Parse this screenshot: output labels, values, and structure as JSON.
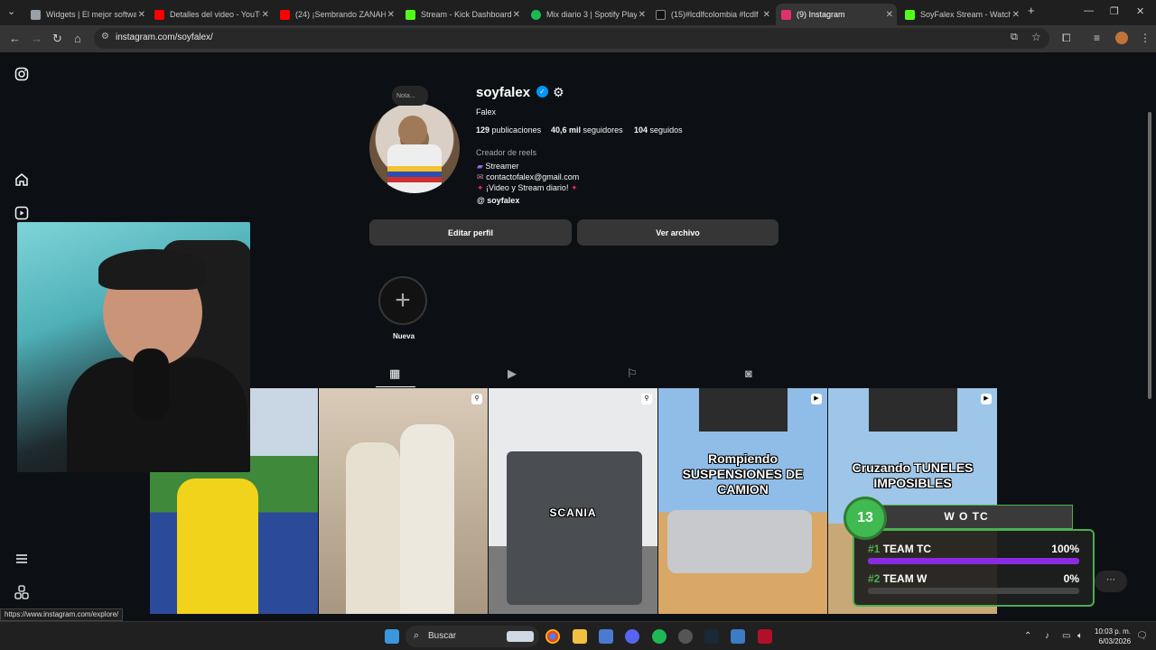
{
  "browser": {
    "tabs": [
      {
        "title": "Widgets | El mejor software",
        "favicon_color": "#9aa0a6"
      },
      {
        "title": "Detalles del video - YouTube",
        "favicon_color": "#ff0000"
      },
      {
        "title": "(24) ¡Sembrando ZANAHORIAS",
        "favicon_color": "#ff0000"
      },
      {
        "title": "Stream - Kick Dashboard",
        "favicon_color": "#53fc18"
      },
      {
        "title": "Mix diario 3 | Spotify Playlist",
        "favicon_color": "#1db954"
      },
      {
        "title": "(15)#lcdlfcolombia #lcdlf",
        "favicon_color": "#111111"
      },
      {
        "title": "(9) Instagram",
        "favicon_color": "#e1306c"
      },
      {
        "title": "SoyFalex Stream - Watch",
        "favicon_color": "#53fc18"
      }
    ],
    "new_tab": "+",
    "url": "instagram.com/soyfalex/",
    "status_link": "https://www.instagram.com/explore/"
  },
  "profile": {
    "username": "soyfalex",
    "full_name": "Falex",
    "note": "Nota...",
    "posts_count": "129",
    "posts_label": "publicaciones",
    "followers_count": "40,6 mil",
    "followers_label": "seguidores",
    "following_count": "104",
    "following_label": "seguidos",
    "category": "Creador de reels",
    "bio": [
      "Streamer",
      "contactofalex@gmail.com",
      "¡Video y Stream diario!"
    ],
    "threads": "soyfalex",
    "edit_button": "Editar perfil",
    "archive_button": "Ver archivo",
    "new_story": "Nueva"
  },
  "posts": [
    {
      "caption": ""
    },
    {
      "caption": ""
    },
    {
      "caption": "SCANIA"
    },
    {
      "caption": "Rompiendo SUSPENSIONES DE CAMION"
    },
    {
      "caption": "Cruzando TUNELES IMPOSIBLES"
    }
  ],
  "overlay": {
    "round": "13",
    "title": "W O TC",
    "teams": [
      {
        "rank": "#1",
        "name": "TEAM TC",
        "percent": "100%",
        "fill": 1.0
      },
      {
        "rank": "#2",
        "name": "TEAM W",
        "percent": "0%",
        "fill": 0.0
      }
    ]
  },
  "taskbar": {
    "search_placeholder": "Buscar",
    "time": "10:03 p. m.",
    "date": "6/03/2026"
  }
}
